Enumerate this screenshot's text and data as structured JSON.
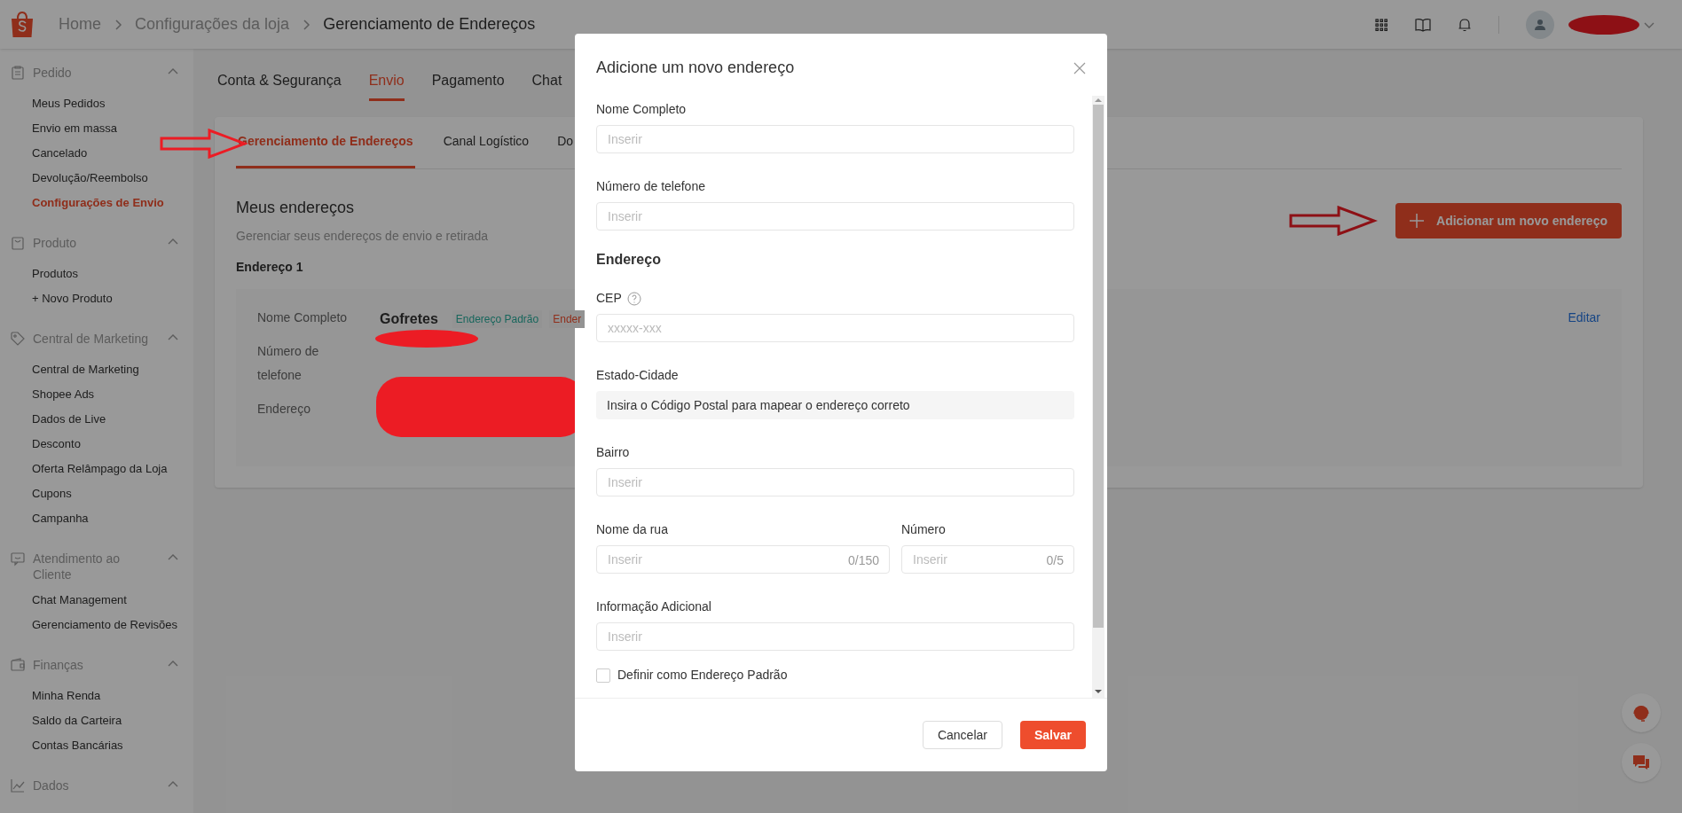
{
  "header": {
    "breadcrumb": [
      "Home",
      "Configurações da loja",
      "Gerenciamento de Endereços"
    ]
  },
  "sidebar": {
    "sections": [
      {
        "title": "Pedido",
        "expanded": true,
        "items": [
          {
            "label": "Meus Pedidos",
            "selected": false
          },
          {
            "label": "Envio em massa",
            "selected": false
          },
          {
            "label": "Cancelado",
            "selected": false
          },
          {
            "label": "Devolução/Reembolso",
            "selected": false
          },
          {
            "label": "Configurações de Envio",
            "selected": true
          }
        ]
      },
      {
        "title": "Produto",
        "expanded": true,
        "items": [
          {
            "label": "Produtos",
            "selected": false
          },
          {
            "label": "+ Novo Produto",
            "selected": false
          }
        ]
      },
      {
        "title": "Central de Marketing",
        "expanded": true,
        "items": [
          {
            "label": "Central de Marketing",
            "selected": false
          },
          {
            "label": "Shopee Ads",
            "selected": false
          },
          {
            "label": "Dados de Live",
            "selected": false
          },
          {
            "label": "Desconto",
            "selected": false
          },
          {
            "label": "Oferta Relâmpago da Loja",
            "selected": false
          },
          {
            "label": "Cupons",
            "selected": false
          },
          {
            "label": "Campanha",
            "selected": false
          }
        ]
      },
      {
        "title": "Atendimento ao Cliente",
        "expanded": true,
        "items": [
          {
            "label": "Chat Management",
            "selected": false
          },
          {
            "label": "Gerenciamento de Revisões",
            "selected": false
          }
        ]
      },
      {
        "title": "Finanças",
        "expanded": true,
        "items": [
          {
            "label": "Minha Renda",
            "selected": false
          },
          {
            "label": "Saldo da Carteira",
            "selected": false
          },
          {
            "label": "Contas Bancárias",
            "selected": false
          }
        ]
      },
      {
        "title": "Dados",
        "expanded": true
      }
    ]
  },
  "tabs": [
    {
      "label": "Conta & Segurança",
      "selected": false
    },
    {
      "label": "Envio",
      "selected": true
    },
    {
      "label": "Pagamento",
      "selected": false
    },
    {
      "label": "Chat",
      "selected": false
    }
  ],
  "subtabs": [
    {
      "label": "Gerenciamento de Endereços",
      "selected": true
    },
    {
      "label": "Canal Logístico",
      "selected": false
    },
    {
      "label": "Do",
      "selected": false
    }
  ],
  "addresses": {
    "title": "Meus endereços",
    "subtitle": "Gerenciar seus endereços de envio e retirada",
    "add_button": "Adicionar um novo endereço"
  },
  "address": {
    "heading": "Endereço 1",
    "name_label": "Nome Completo",
    "name": "Gofretes",
    "tags": [
      {
        "label": "Endereço Padrão",
        "color": "#17665c"
      },
      {
        "label": "Ender",
        "color": "#8f2e1b"
      }
    ],
    "phone_label": "Número de telefone",
    "address_label": "Endereço",
    "edit": "Editar"
  },
  "modal": {
    "title": "Adicione um novo endereço",
    "fields": [
      {
        "kind": "input",
        "label": "Nome Completo",
        "placeholder": "Inserir"
      },
      {
        "kind": "input",
        "label": "Número de telefone",
        "placeholder": "Inserir"
      },
      {
        "kind": "heading",
        "label": "Endereço"
      },
      {
        "kind": "input",
        "label": "CEP",
        "placeholder": "xxxxx-xxx",
        "help": true
      },
      {
        "kind": "readonly",
        "label": "Estado-Cidade",
        "value": "Insira o Código Postal para mapear o endereço correto"
      },
      {
        "kind": "input",
        "label": "Bairro",
        "placeholder": "Inserir"
      },
      {
        "kind": "row",
        "fields": [
          {
            "label": "Nome da rua",
            "placeholder": "Inserir",
            "counter": "0/150"
          },
          {
            "label": "Número",
            "placeholder": "Inserir",
            "counter": "0/5"
          }
        ]
      },
      {
        "kind": "input",
        "label": "Informação Adicional",
        "placeholder": "Inserir"
      },
      {
        "kind": "checkbox",
        "label": "Definir como Endereço Padrão",
        "checked": false
      }
    ],
    "cancel": "Cancelar",
    "save": "Salvar"
  }
}
